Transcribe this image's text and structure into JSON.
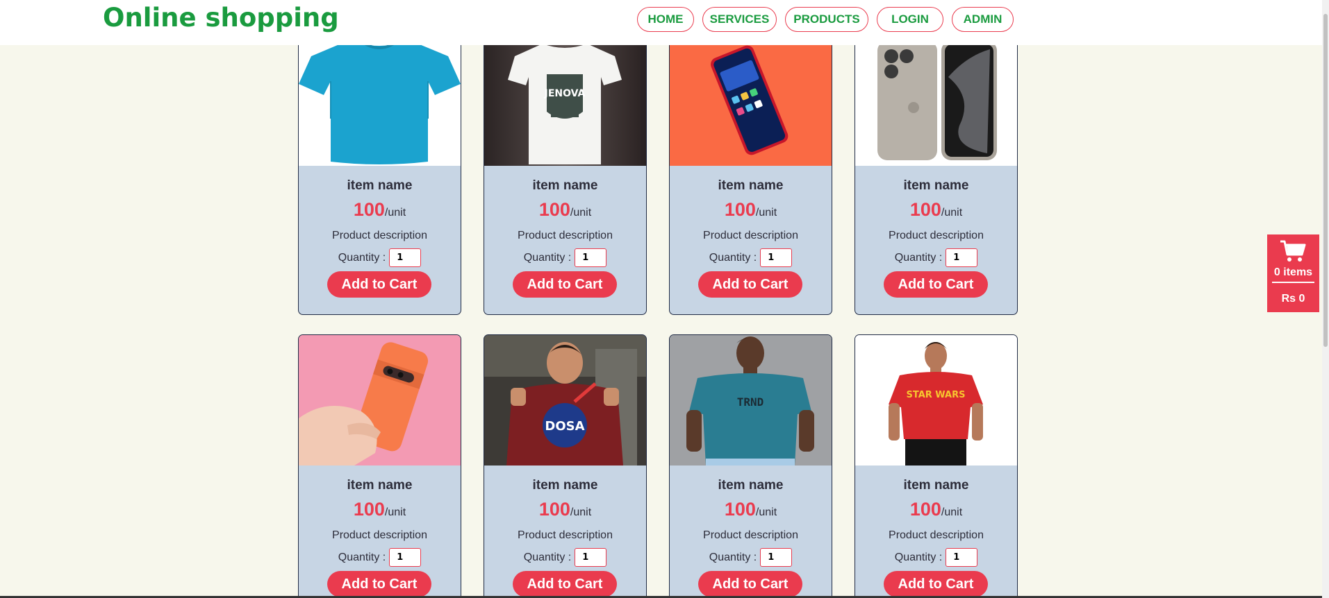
{
  "header": {
    "brand": "Online shopping",
    "nav": [
      "HOME",
      "SERVICES",
      "PRODUCTS",
      "LOGIN",
      "ADMIN"
    ]
  },
  "products": [
    {
      "name": "item name",
      "price": "100",
      "unit": "/unit",
      "description": "Product description",
      "quantity_label": "Quantity :",
      "quantity": "1",
      "button": "Add to Cart",
      "image": "blue-tshirt"
    },
    {
      "name": "item name",
      "price": "100",
      "unit": "/unit",
      "description": "Product description",
      "quantity_label": "Quantity :",
      "quantity": "1",
      "button": "Add to Cart",
      "image": "white-graphic-tshirt"
    },
    {
      "name": "item name",
      "price": "100",
      "unit": "/unit",
      "description": "Product description",
      "quantity_label": "Quantity :",
      "quantity": "1",
      "button": "Add to Cart",
      "image": "red-smartphone"
    },
    {
      "name": "item name",
      "price": "100",
      "unit": "/unit",
      "description": "Product description",
      "quantity_label": "Quantity :",
      "quantity": "1",
      "button": "Add to Cart",
      "image": "titanium-iphone"
    },
    {
      "name": "item name",
      "price": "100",
      "unit": "/unit",
      "description": "Product description",
      "quantity_label": "Quantity :",
      "quantity": "1",
      "button": "Add to Cart",
      "image": "orange-pixel-phone"
    },
    {
      "name": "item name",
      "price": "100",
      "unit": "/unit",
      "description": "Product description",
      "quantity_label": "Quantity :",
      "quantity": "1",
      "button": "Add to Cart",
      "image": "maroon-dosa-tshirt"
    },
    {
      "name": "item name",
      "price": "100",
      "unit": "/unit",
      "description": "Product description",
      "quantity_label": "Quantity :",
      "quantity": "1",
      "button": "Add to Cart",
      "image": "teal-tshirt-model"
    },
    {
      "name": "item name",
      "price": "100",
      "unit": "/unit",
      "description": "Product description",
      "quantity_label": "Quantity :",
      "quantity": "1",
      "button": "Add to Cart",
      "image": "red-star-wars-tshirt"
    }
  ],
  "image_text": {
    "jenova": "JENOVA",
    "dosa": "DOSA",
    "star_wars": "STAR WARS",
    "teal_print": "TRND"
  },
  "cart": {
    "icon": "shopping-cart-icon",
    "items": "0 items",
    "total": "Rs 0"
  },
  "colors": {
    "brand_green": "#1a9b3f",
    "accent_red": "#ea3b4e",
    "card_bg": "#c7d5e4",
    "page_bg": "#f7f7ec"
  }
}
